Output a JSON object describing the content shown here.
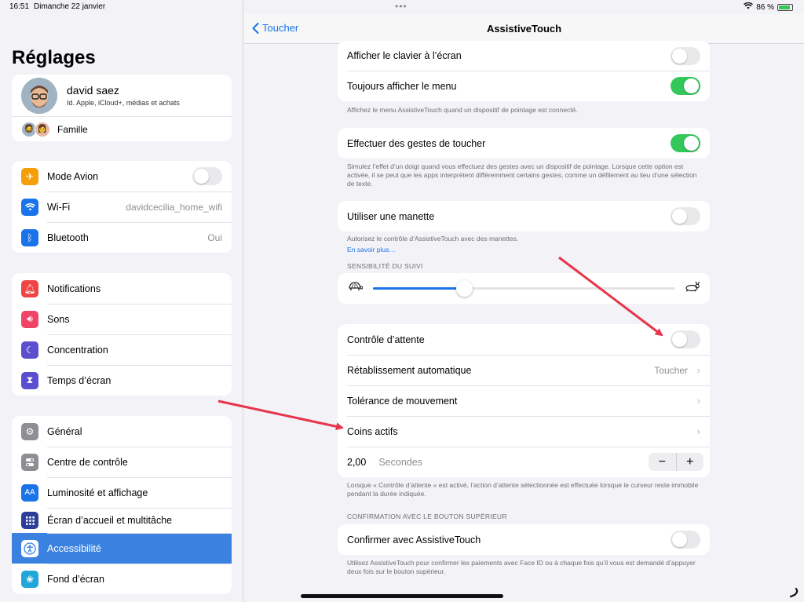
{
  "status": {
    "time": "16:51",
    "date": "Dimanche 22 janvier",
    "battery": "86 %"
  },
  "sidebar": {
    "title": "Réglages",
    "profile": {
      "name": "david saez",
      "subtitle": "Id. Apple, iCloud+, médias et achats",
      "family": "Famille"
    },
    "group1": [
      {
        "label": "Mode Avion",
        "icon": "airplane-icon",
        "color": "#f59e0b",
        "toggle": false
      },
      {
        "label": "Wi-Fi",
        "icon": "wifi-icon",
        "color": "#1a73e8",
        "value": "davidcecilia_home_wifi"
      },
      {
        "label": "Bluetooth",
        "icon": "bluetooth-icon",
        "color": "#1a73e8",
        "value": "Oui"
      }
    ],
    "group2": [
      {
        "label": "Notifications",
        "icon": "bell-icon",
        "color": "#ef4444"
      },
      {
        "label": "Sons",
        "icon": "speaker-icon",
        "color": "#ef4466"
      },
      {
        "label": "Concentration",
        "icon": "moon-icon",
        "color": "#5b4fcf"
      },
      {
        "label": "Temps d’écran",
        "icon": "hourglass-icon",
        "color": "#5b4fcf"
      }
    ],
    "group3": [
      {
        "label": "Général",
        "icon": "gear-icon",
        "color": "#8e8e93"
      },
      {
        "label": "Centre de contrôle",
        "icon": "switches-icon",
        "color": "#8e8e93"
      },
      {
        "label": "Luminosité et affichage",
        "icon": "text-size-icon",
        "color": "#1a73e8"
      },
      {
        "label": "Écran d’accueil et multitâche",
        "icon": "grid-icon",
        "color": "#2c3e9a"
      },
      {
        "label": "Accessibilité",
        "icon": "accessibility-icon",
        "color": "#1a73e8",
        "selected": true
      },
      {
        "label": "Fond d’écran",
        "icon": "flower-icon",
        "color": "#1ea7d8"
      }
    ]
  },
  "detail": {
    "back_label": "Toucher",
    "title": "AssistiveTouch",
    "rows": {
      "show_keyboard": "Afficher le clavier à l’écran",
      "always_show_menu": "Toujours afficher le menu",
      "tap_gestures": "Effectuer des gestes de toucher",
      "use_controller": "Utiliser une manette",
      "dwell_control": "Contrôle d’attente",
      "auto_revert": "Rétablissement automatique",
      "auto_revert_value": "Toucher",
      "movement_tolerance": "Tolérance de mouvement",
      "hot_corners": "Coins actifs",
      "seconds_value": "2,00",
      "seconds_label": "Secondes",
      "confirm_assistive": "Confirmer avec AssistiveTouch"
    },
    "notes": {
      "menu_note": "Affichez le menu AssistiveTouch quand un dispositif de pointage est connecté.",
      "gestures_note": "Simulez l’effet d’un doigt quand vous effectuez des gestes avec un dispositif de pointage. Lorsque cette option est activée, il se peut que les apps interprètent différemment certains gestes, comme un défilement au lieu d’une sélection de texte.",
      "controller_note": "Autorisez le contrôle d’AssistiveTouch avec des manettes.",
      "learn_more": "En savoir plus…",
      "dwell_note": "Lorsque « Contrôle d’attente » est activé, l’action d’attente sélectionnée est effectuée lorsque le curseur reste immobile pendant la durée indiquée.",
      "confirm_note": "Utilisez AssistiveTouch pour confirmer les paiements avec Face ID ou à chaque fois qu’il vous est demandé d’appuyer deux fois sur le bouton supérieur."
    },
    "sections": {
      "tracking": "SENSIBILITÉ DU SUIVI",
      "confirmation": "CONFIRMATION AVEC LE BOUTON SUPÉRIEUR"
    },
    "toggles": {
      "show_keyboard": false,
      "always_show_menu": true,
      "tap_gestures": true,
      "use_controller": false,
      "dwell_control": false,
      "confirm_assistive": false
    },
    "tracking_level": 0.3,
    "stepper": {
      "minus": "−",
      "plus": "+"
    }
  },
  "colors": {
    "accent": "#1a73e8",
    "toggle_on": "#34c759",
    "arrow": "#e8344a"
  }
}
